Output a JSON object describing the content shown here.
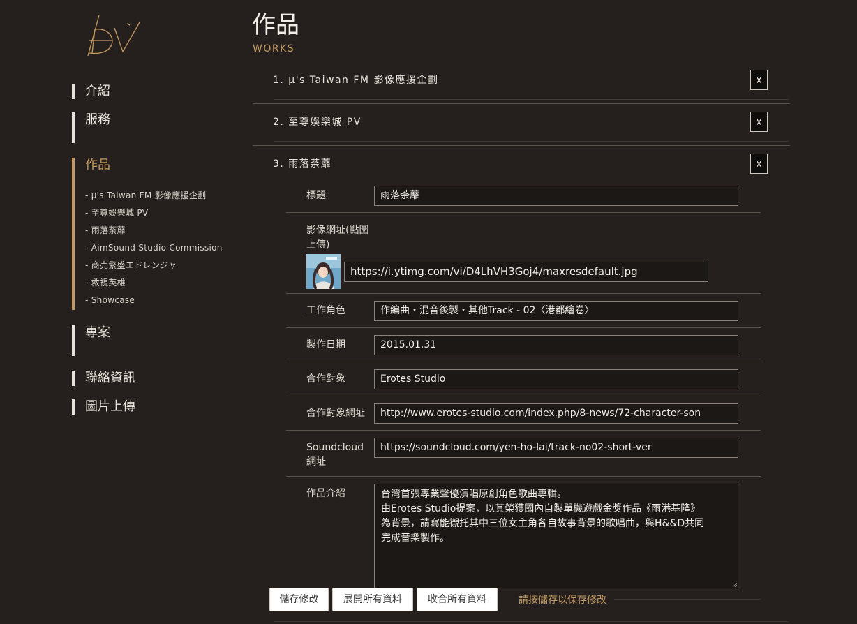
{
  "brand": {
    "logo": "DV logo"
  },
  "nav": {
    "intro": "介紹",
    "services": "服務",
    "works": "作品",
    "works_sub": [
      "- µ's Taiwan FM 影像應援企劃",
      "- 至尊娛樂城 PV",
      "- 雨落荼蘼",
      "- AimSound Studio Commission",
      "- 商売繁盛エドレンジャ",
      "- 救視英雄",
      "- Showcase"
    ],
    "projects": "專案",
    "contact": "聯絡資訊",
    "upload": "圖片上傳"
  },
  "header": {
    "title": "作品",
    "subtitle": "WORKS"
  },
  "works": [
    {
      "title": "1. µ's Taiwan FM 影像應援企劃",
      "close": "x"
    },
    {
      "title": "2. 至尊娛樂城 PV",
      "close": "x"
    },
    {
      "title": "3. 雨落荼蘼",
      "close": "x"
    }
  ],
  "form": {
    "title_label": "標題",
    "title_value": "雨落荼蘼",
    "image_label": "影像網址(點圖上傳)",
    "image_value": "https://i.ytimg.com/vi/D4LhVH3Goj4/maxresdefault.jpg",
    "role_label": "工作角色",
    "role_value": "作編曲・混音後製・其他Track - 02〈港都繪卷〉",
    "date_label": "製作日期",
    "date_value": "2015.01.31",
    "partner_label": "合作對象",
    "partner_value": "Erotes Studio",
    "partner_url_label": "合作對象網址",
    "partner_url_value": "http://www.erotes-studio.com/index.php/8-news/72-character-son",
    "soundcloud_label": "Soundcloud網址",
    "soundcloud_value": "https://soundcloud.com/yen-ho-lai/track-no02-short-ver",
    "desc_label": "作品介紹",
    "desc_lines": [
      "台灣首張專業聲優演唱原創角色歌曲專輯。",
      "由Erotes Studio提案，以其榮獲國內自製單機遊戲金獎作品《雨港基隆》",
      "為背景，請寫能襯托其中三位女主角各自故事背景的歌唱曲，與H&&D共同",
      "完成音樂製作。"
    ]
  },
  "actions": {
    "save": "儲存修改",
    "expand_all": "展開所有資料",
    "collapse_all": "收合所有資料",
    "hint": "請按儲存以保存修改"
  },
  "colors": {
    "background": "#25201d",
    "accent": "#c59a62",
    "text": "#e8e2da"
  }
}
